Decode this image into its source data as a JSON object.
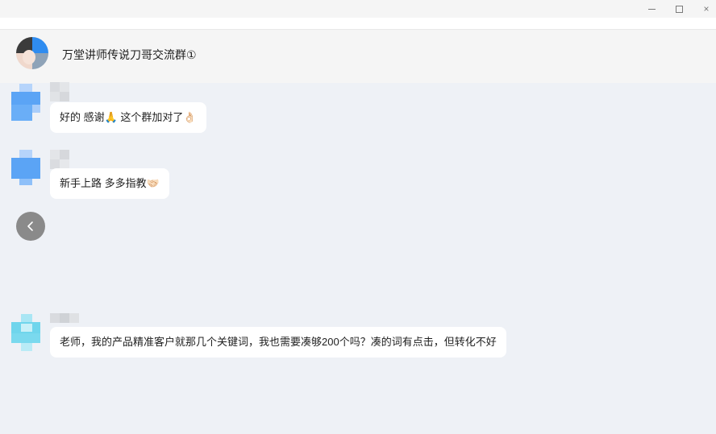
{
  "window": {
    "minimize_icon": "minimize-icon",
    "maximize_icon": "maximize-icon",
    "close_icon": "close-icon",
    "close_glyph": "×"
  },
  "header": {
    "group_name": "万堂讲师传说刀哥交流群①"
  },
  "messages": [
    {
      "text": "好的 感谢🙏 这个群加对了👌🏻"
    },
    {
      "text": "新手上路 多多指教🤝🏻"
    },
    {
      "text": "老师，我的产品精准客户就那几个关键词，我也需要凑够200个吗？凑的词有点击，但转化不好"
    }
  ],
  "controls": {
    "back_icon": "chevron-left-icon"
  },
  "colors": {
    "chat_background": "#eef1f6",
    "bubble_background": "#ffffff",
    "avatar_blue": "#5ba4f5",
    "avatar_cyan": "#6fd5ec"
  }
}
